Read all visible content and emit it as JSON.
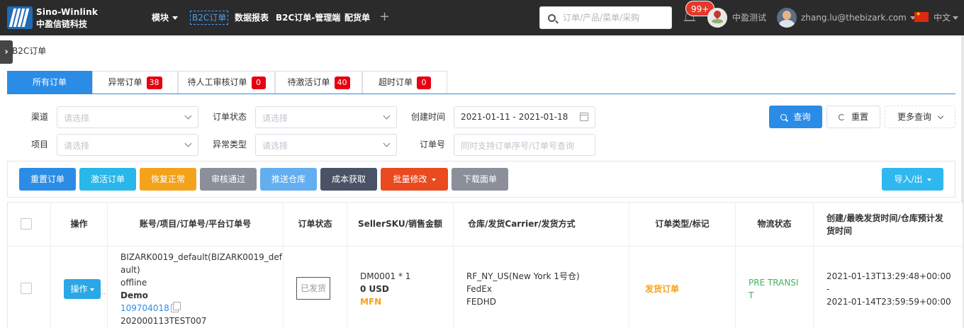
{
  "brand": {
    "name_en": "Sino-Winlink",
    "name_cn": "中盈信链科技"
  },
  "nav": {
    "module_label": "模块",
    "items": [
      "B2C订单",
      "数据报表",
      "B2C订单-管理端",
      "配货单"
    ],
    "add_symbol": "+"
  },
  "search": {
    "placeholder": "订单/产品/菜单/采购"
  },
  "notifications": {
    "badge": "99+"
  },
  "org": {
    "name": "中盈测试"
  },
  "user": {
    "email": "zhang.lu@thebizark.com"
  },
  "language": {
    "label": "中文"
  },
  "breadcrumb": {
    "toggle": "›",
    "title": "B2C订单"
  },
  "tabs": [
    {
      "label": "所有订单",
      "count": ""
    },
    {
      "label": "异常订单",
      "count": "38"
    },
    {
      "label": "待人工审核订单",
      "count": "0"
    },
    {
      "label": "待激活订单",
      "count": "40"
    },
    {
      "label": "超时订单",
      "count": "0"
    }
  ],
  "filters": {
    "channel_label": "渠道",
    "channel_placeholder": "请选择",
    "status_label": "订单状态",
    "status_placeholder": "请选择",
    "created_label": "创建时间",
    "created_value": "2021-01-11 - 2021-01-18",
    "project_label": "项目",
    "project_placeholder": "请选择",
    "exception_label": "异常类型",
    "exception_placeholder": "请选择",
    "order_no_label": "订单号",
    "order_no_placeholder": "同时支持订单序号/订单号查询"
  },
  "filter_buttons": {
    "query": "查询",
    "reset": "重置",
    "more": "更多查询"
  },
  "actions": [
    {
      "label": "重置订单",
      "color": "#2b8ce6"
    },
    {
      "label": "激活订单",
      "color": "#29b6e8"
    },
    {
      "label": "恢复正常",
      "color": "#f5a21b"
    },
    {
      "label": "审核通过",
      "color": "#8a8f99"
    },
    {
      "label": "推送仓库",
      "color": "#63aef0"
    },
    {
      "label": "成本获取",
      "color": "#4a5266"
    },
    {
      "label": "批量修改",
      "color": "#ea4a1f"
    },
    {
      "label": "下载面单",
      "color": "#8a8f99"
    }
  ],
  "import_export": {
    "label": "导入/出",
    "color": "#2fb8ef"
  },
  "table": {
    "headers": {
      "op": "操作",
      "account": "账号/项目/订单号/平台订单号",
      "status": "订单状态",
      "sku": "SellerSKU/销售金额",
      "warehouse": "仓库/发货Carrier/发货方式",
      "type": "订单类型/标记",
      "logistics": "物流状态",
      "times_1": "创建/最晚发货时间/仓库预计发",
      "times_2": "货时间"
    },
    "row": {
      "op_button": "操作",
      "account_1": "BIZARK0019_default(BIZARK0019_def",
      "account_2": "ault)",
      "account_3": "offline",
      "account_4": "Demo",
      "order_id": "109704018",
      "platform_order": "202000113TEST007",
      "status": "已发货",
      "sku": "DM0001 * 1",
      "amount": "0 USD",
      "fulfillment": "MFN",
      "warehouse": "RF_NY_US(New York 1号仓)",
      "carrier": "FedEx",
      "method": "FEDHD",
      "order_type": "发货订单",
      "logistics_1": "PRE TRANSI",
      "logistics_2": "T",
      "time_1": "2021-01-13T13:29:48+00:00",
      "time_sep": "-",
      "time_2": "2021-01-14T23:59:59+00:00"
    }
  },
  "colors": {
    "accent": "#2b8ce6",
    "badge_red": "#e60012",
    "order_type": "#f5a21b",
    "logistics": "#3fb55e",
    "link": "#2b8ce6"
  }
}
